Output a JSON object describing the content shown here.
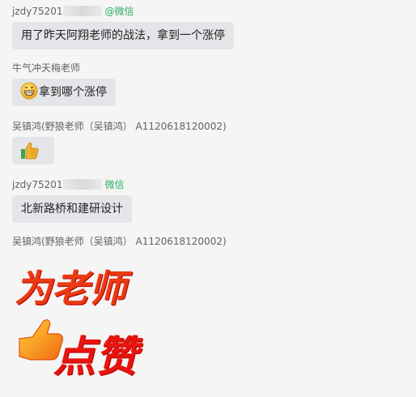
{
  "messages": [
    {
      "sender_prefix": "jzdy75201",
      "sender_tag": "@微信",
      "text": "用了昨天阿翔老师的战法，拿到一个涨停"
    },
    {
      "sender": "牛气冲天梅老师",
      "emoji": "grinning-face-icon",
      "text": "拿到哪个涨停"
    },
    {
      "sender": "吴镇鸿(野狼老师（吴镇鸿） A1120618120002)",
      "emoji": "thumbs-up-icon"
    },
    {
      "sender_prefix": "jzdy75201",
      "sender_tag": "微信",
      "text": "北新路桥和建研设计"
    },
    {
      "sender": "吴镇鸿(野狼老师（吴镇鸿） A1120618120002)",
      "sticker_line1": "为老师",
      "sticker_line2": "点赞",
      "sticker_icon": "thumbs-up-icon"
    }
  ],
  "colors": {
    "background": "#f5f5f5",
    "bubble": "#e3e5e8",
    "wechat_tag": "#2bae67",
    "sticker_red": "#e8140e"
  }
}
